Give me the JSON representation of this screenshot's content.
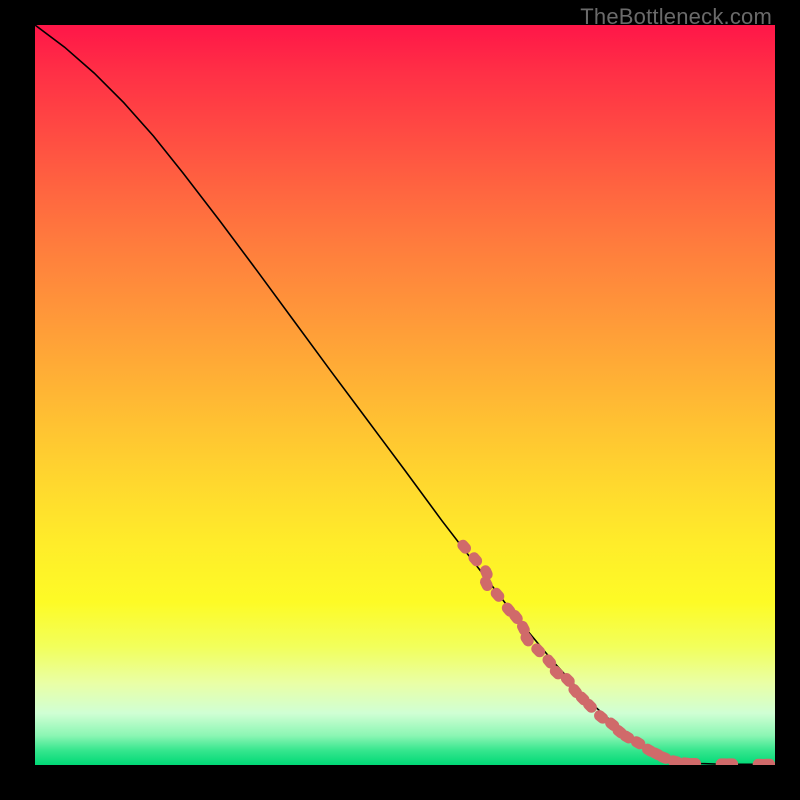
{
  "watermark": "TheBottleneck.com",
  "colors": {
    "marker": "#d06a6a",
    "curve": "#000000",
    "frame_bg": "#000000"
  },
  "chart_data": {
    "type": "line",
    "title": "",
    "xlabel": "",
    "ylabel": "",
    "xlim": [
      0,
      100
    ],
    "ylim": [
      0,
      100
    ],
    "grid": false,
    "legend": false,
    "series": [
      {
        "name": "curve",
        "x": [
          0,
          4,
          8,
          12,
          16,
          20,
          25,
          30,
          35,
          40,
          45,
          50,
          55,
          60,
          65,
          70,
          75,
          80,
          84,
          87,
          90,
          93,
          95,
          97,
          100
        ],
        "y": [
          100,
          97,
          93.5,
          89.5,
          85,
          80,
          73.5,
          66.8,
          60,
          53.2,
          46.5,
          39.8,
          33,
          26.5,
          20,
          14,
          8.5,
          4,
          1.5,
          0.5,
          0.2,
          0.1,
          0.1,
          0.1,
          0.1
        ]
      }
    ],
    "markers": {
      "name": "highlighted-segment",
      "points": [
        {
          "x": 58,
          "y": 29.5
        },
        {
          "x": 59.5,
          "y": 27.8
        },
        {
          "x": 61,
          "y": 26
        },
        {
          "x": 61,
          "y": 24.5
        },
        {
          "x": 62.5,
          "y": 23
        },
        {
          "x": 64,
          "y": 21
        },
        {
          "x": 65,
          "y": 20
        },
        {
          "x": 66,
          "y": 18.5
        },
        {
          "x": 66.5,
          "y": 17
        },
        {
          "x": 68,
          "y": 15.5
        },
        {
          "x": 69.5,
          "y": 14
        },
        {
          "x": 70.5,
          "y": 12.5
        },
        {
          "x": 72,
          "y": 11.5
        },
        {
          "x": 73,
          "y": 10
        },
        {
          "x": 74,
          "y": 9
        },
        {
          "x": 75,
          "y": 8
        },
        {
          "x": 76.5,
          "y": 6.5
        },
        {
          "x": 78,
          "y": 5.5
        },
        {
          "x": 79,
          "y": 4.5
        },
        {
          "x": 80,
          "y": 3.8
        },
        {
          "x": 81.5,
          "y": 3
        },
        {
          "x": 83,
          "y": 2
        },
        {
          "x": 84,
          "y": 1.5
        },
        {
          "x": 85,
          "y": 1
        },
        {
          "x": 86.5,
          "y": 0.5
        },
        {
          "x": 88,
          "y": 0.25
        },
        {
          "x": 89,
          "y": 0.2
        },
        {
          "x": 93,
          "y": 0.15
        },
        {
          "x": 94,
          "y": 0.15
        },
        {
          "x": 98,
          "y": 0.1
        },
        {
          "x": 99,
          "y": 0.1
        }
      ]
    }
  }
}
